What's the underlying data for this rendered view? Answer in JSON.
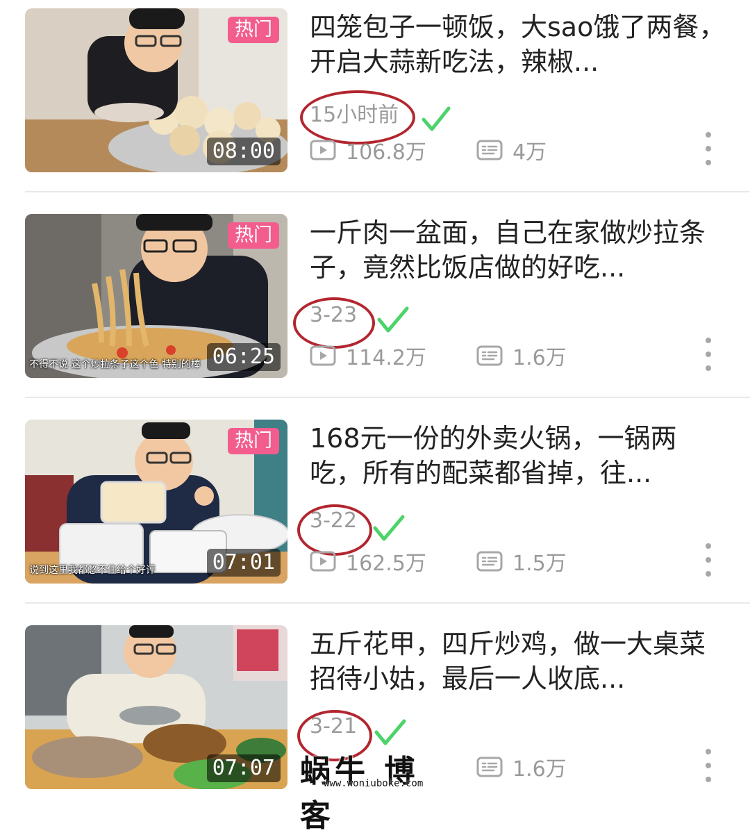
{
  "colors": {
    "accent_pink": "#f25d8e",
    "annotation_red": "#b3262f",
    "check_green": "#4cd36a",
    "meta_gray": "#9a9a9a"
  },
  "videos": [
    {
      "title": "四笼包子一顿饭，大sao饿了两餐，开启大蒜新吃法，辣椒...",
      "badge": "热门",
      "duration": "08:00",
      "date": "15小时前",
      "plays": "106.8万",
      "comments": "4万",
      "subtitle": "",
      "play_icon": "play-icon",
      "comment_icon": "danmaku-icon"
    },
    {
      "title": "一斤肉一盆面，自己在家做炒拉条子，竟然比饭店做的好吃...",
      "badge": "热门",
      "duration": "06:25",
      "date": "3-23",
      "plays": "114.2万",
      "comments": "1.6万",
      "subtitle": "不得不说 这个炒拉条子这个色 特别的棒",
      "play_icon": "play-icon",
      "comment_icon": "danmaku-icon"
    },
    {
      "title": "168元一份的外卖火锅，一锅两吃，所有的配菜都省掉，往...",
      "badge": "热门",
      "duration": "07:01",
      "date": "3-22",
      "plays": "162.5万",
      "comments": "1.5万",
      "subtitle": "说到这里我都憋不住给个好评",
      "play_icon": "play-icon",
      "comment_icon": "danmaku-icon"
    },
    {
      "title": "五斤花甲，四斤炒鸡，做一大桌菜招待小姑，最后一人收底...",
      "badge": "",
      "duration": "07:07",
      "date": "3-21",
      "plays": "",
      "comments": "1.6万",
      "subtitle": "",
      "play_icon": "",
      "comment_icon": "danmaku-icon"
    }
  ],
  "watermark": {
    "text": "蜗牛 博客",
    "url": "www.woniuboke.com"
  }
}
